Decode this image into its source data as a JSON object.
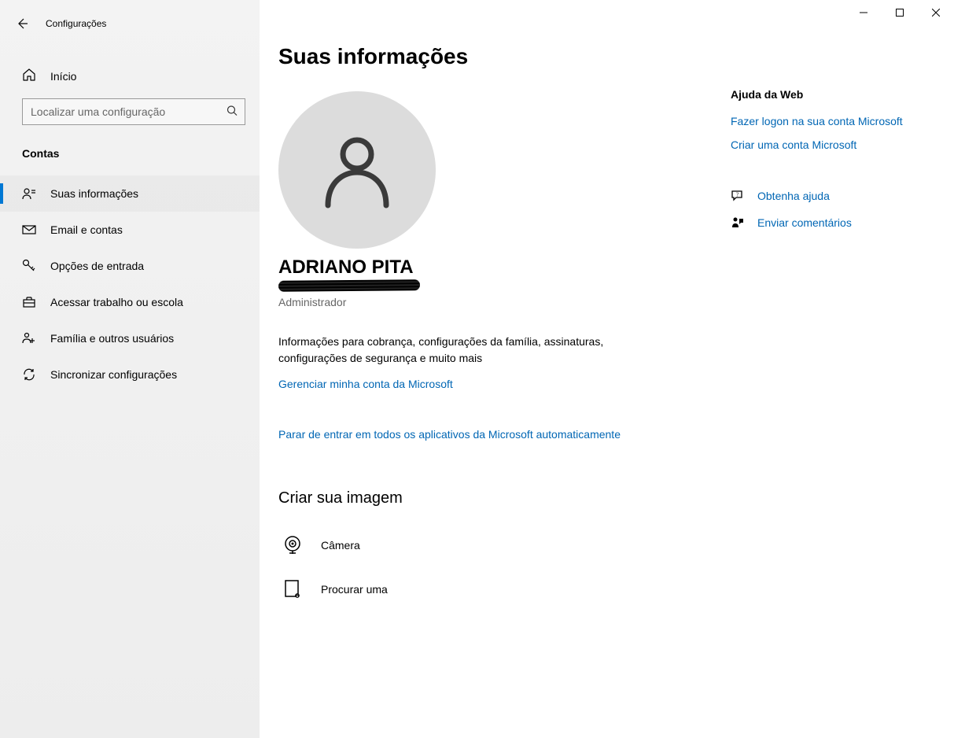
{
  "window": {
    "app_title": "Configurações"
  },
  "sidebar": {
    "home_label": "Início",
    "search_placeholder": "Localizar uma configuração",
    "section_label": "Contas",
    "items": [
      {
        "label": "Suas informações"
      },
      {
        "label": "Email e contas"
      },
      {
        "label": "Opções de entrada"
      },
      {
        "label": "Acessar trabalho ou escola"
      },
      {
        "label": "Família e outros usuários"
      },
      {
        "label": "Sincronizar configurações"
      }
    ]
  },
  "main": {
    "page_title": "Suas informações",
    "user_name": "ADRIANO PITA",
    "user_role": "Administrador",
    "info_paragraph": "Informações para cobrança, configurações da família, assinaturas, configurações de segurança e muito mais",
    "manage_link": "Gerenciar minha conta da Microsoft",
    "stop_signin_link": "Parar de entrar em todos os aplicativos da Microsoft automaticamente",
    "create_image_heading": "Criar sua imagem",
    "camera_label": "Câmera",
    "browse_label": "Procurar uma"
  },
  "aside": {
    "help_heading": "Ajuda da Web",
    "signin_link": "Fazer logon na sua conta Microsoft",
    "create_account_link": "Criar uma conta Microsoft",
    "get_help_link": "Obtenha ajuda",
    "send_feedback_link": "Enviar comentários"
  }
}
